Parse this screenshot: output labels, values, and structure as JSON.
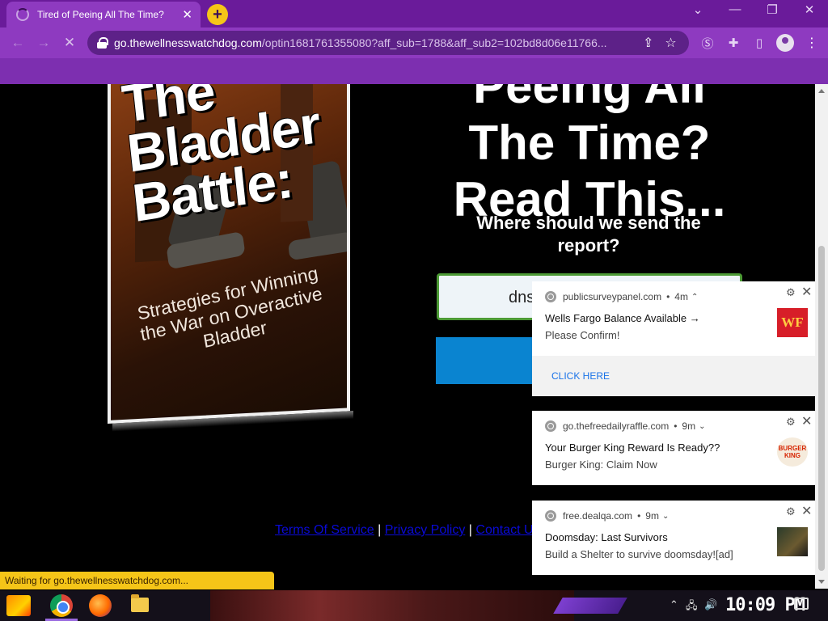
{
  "browser": {
    "tab_title": "Tired of Peeing All The Time?",
    "tab_close": "✕",
    "new_tab": "+",
    "url_domain": "go.thewellnesswatchdog.com",
    "url_path": "/optin1681761355080?aff_sub=1788&aff_sub2=102bd8d06e11766...",
    "status_text": "Waiting for go.thewellnesswatchdog.com..."
  },
  "page": {
    "book": {
      "title_lines": [
        "The",
        "Bladder",
        "Battle:"
      ],
      "subtitle": "Strategies for Winning the War on Overactive Bladder"
    },
    "headline": {
      "line1": "Peeing All",
      "line2": "The Time?",
      "line3": "Read This..."
    },
    "subheadline": "Where should we send the report?",
    "email_value": "dns",
    "footer": {
      "terms": "Terms Of Service",
      "separator": "|",
      "privacy": "Privacy Policy",
      "contact": "Contact U"
    }
  },
  "notifications": [
    {
      "source": "publicsurveypanel.com",
      "age": "4m",
      "caret": "⌃",
      "title": "Wells Fargo Balance Available →",
      "body": "Please Confirm!",
      "image_text": "WF",
      "image_color": "#d71e28",
      "image_text_color": "#ffcd41",
      "action": "CLICK HERE"
    },
    {
      "source": "go.thefreedailyraffle.com",
      "age": "9m",
      "caret": "⌄",
      "title": "Your Burger King Reward Is Ready??",
      "body": "Burger King:  Claim Now",
      "image_text": "BURGER KING",
      "image_color": "#f5ebdc",
      "image_text_color": "#d62300"
    },
    {
      "source": "free.dealqa.com",
      "age": "9m",
      "caret": "⌄",
      "title": "Doomsday: Last Survivors",
      "body": "Build a Shelter to survive doomsday![ad]",
      "image_text": "",
      "image_color": "#2a3a2a",
      "image_text_color": "#ffffff"
    }
  ],
  "taskbar": {
    "clock": "10:09 PM"
  },
  "colors": {
    "accent": "#8e3ac0",
    "tabstrip": "#6a1b9a",
    "submit_button": "#0a84d0",
    "input_border": "#4c9a35"
  }
}
